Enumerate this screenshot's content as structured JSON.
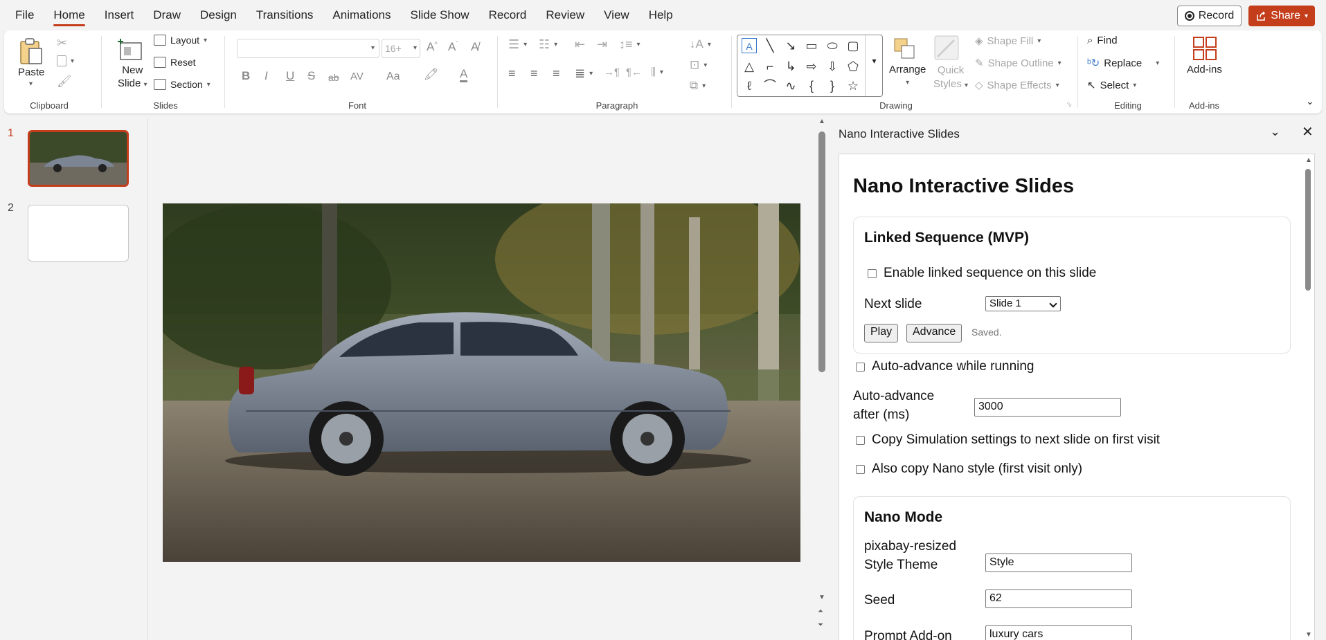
{
  "menu": {
    "items": [
      "File",
      "Home",
      "Insert",
      "Draw",
      "Design",
      "Transitions",
      "Animations",
      "Slide Show",
      "Record",
      "Review",
      "View",
      "Help"
    ],
    "active": "Home",
    "record_label": "Record",
    "share_label": "Share"
  },
  "ribbon": {
    "clipboard": {
      "paste": "Paste",
      "label": "Clipboard"
    },
    "slides": {
      "new_slide": "New",
      "new_slide2": "Slide",
      "layout": "Layout",
      "reset": "Reset",
      "section": "Section",
      "label": "Slides"
    },
    "font": {
      "size_placeholder": "16+",
      "label": "Font",
      "formats": [
        "B",
        "I",
        "U",
        "S",
        "ab",
        "AV",
        "Aa"
      ]
    },
    "paragraph": {
      "label": "Paragraph"
    },
    "drawing": {
      "arrange": "Arrange",
      "quick_styles_1": "Quick",
      "quick_styles_2": "Styles",
      "shape_fill": "Shape Fill",
      "shape_outline": "Shape Outline",
      "shape_effects": "Shape Effects",
      "label": "Drawing"
    },
    "editing": {
      "find": "Find",
      "replace": "Replace",
      "select": "Select",
      "label": "Editing"
    },
    "addins": {
      "addins": "Add-ins",
      "label": "Add-ins"
    }
  },
  "thumbnails": [
    {
      "num": "1",
      "active": true
    },
    {
      "num": "2",
      "active": false
    }
  ],
  "taskpane": {
    "title": "Nano Interactive Slides",
    "heading": "Nano Interactive Slides",
    "linked": {
      "title": "Linked Sequence (MVP)",
      "enable_label": "Enable linked sequence on this slide",
      "next_slide_label": "Next slide",
      "next_slide_value": "Slide 1",
      "play": "Play",
      "advance": "Advance",
      "status": "Saved."
    },
    "auto_advance_label": "Auto-advance while running",
    "auto_after_label_1": "Auto-advance",
    "auto_after_label_2": "after (ms)",
    "auto_after_value": "3000",
    "copy_sim_label": "Copy Simulation settings to next slide on first visit",
    "copy_style_label": "Also copy Nano style (first visit only)",
    "nano": {
      "title": "Nano Mode",
      "style_theme_label_1": "pixabay-resized",
      "style_theme_label_2": "Style Theme",
      "style_theme_value": "Style",
      "seed_label": "Seed",
      "seed_value": "62",
      "prompt_label": "Prompt Add-on",
      "prompt_value": "luxury cars"
    }
  },
  "colors": {
    "accent": "#c43e1c",
    "car": "#7b8594"
  }
}
